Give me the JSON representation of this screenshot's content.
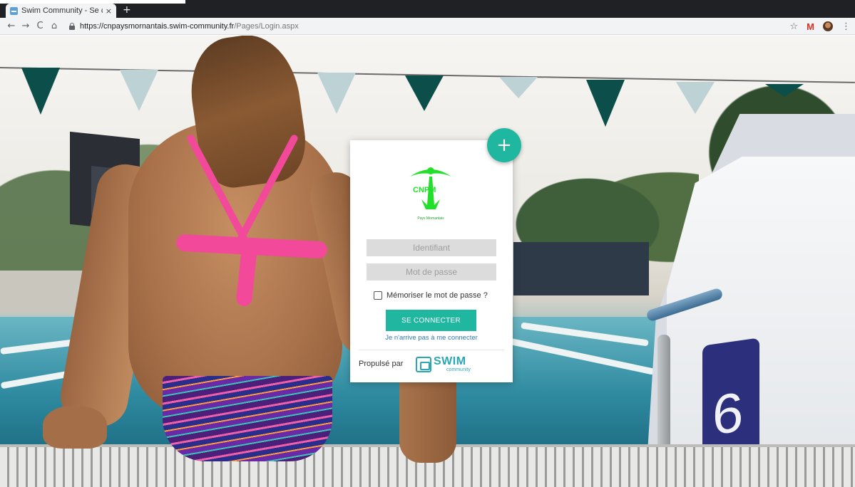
{
  "browser": {
    "tab_title": "Swim Community - Se conn",
    "tab_close": "×",
    "new_tab": "+",
    "url_host": "https://cnpaysmornantais.swim-community.fr",
    "url_path": "/Pages/Login.aspx",
    "icons": [
      "back-arrow-icon",
      "forward-arrow-icon",
      "reload-icon",
      "home-icon",
      "lock-icon",
      "star-icon",
      "gmail-icon",
      "profile-icon",
      "menu-dots-icon"
    ]
  },
  "login": {
    "logo_letters": "CNPM",
    "logo_caption": "Pays Mornantais",
    "username_placeholder": "Identifiant",
    "password_placeholder": "Mot de passe",
    "remember_label": "Mémoriser le mot de passe ?",
    "connect_label": "SE CONNECTER",
    "forgot_link": "Je n'arrive pas à me connecter",
    "powered_by": "Propulsé par",
    "brand_name": "SWIM",
    "brand_sub": "community",
    "fab_symbol": "+"
  },
  "background": {
    "starting_block_number": "6"
  },
  "colors": {
    "accent": "#1fb7a0",
    "link": "#2f79b6",
    "brand": "#2aa7b5",
    "logo_green": "#22e02a"
  }
}
